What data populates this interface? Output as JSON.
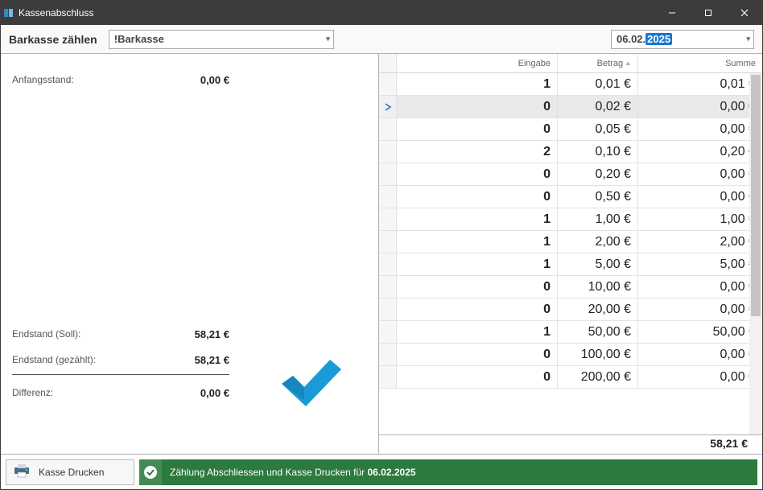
{
  "window": {
    "title": "Kassenabschluss"
  },
  "toolbar": {
    "label": "Barkasse zählen",
    "cashbox": "!Barkasse",
    "date_prefix": "06.02.",
    "date_sel": "2025"
  },
  "summary": {
    "start_label": "Anfangsstand:",
    "start_value": "0,00 €",
    "soll_label": "Endstand (Soll):",
    "soll_value": "58,21 €",
    "counted_label": "Endstand (gezählt):",
    "counted_value": "58,21 €",
    "diff_label": "Differenz:",
    "diff_value": "0,00 €"
  },
  "grid": {
    "headers": {
      "input": "Eingabe",
      "amount": "Betrag",
      "sum": "Summe"
    },
    "active_index": 1,
    "rows": [
      {
        "q": "1",
        "amt": "0,01 €",
        "sum": "0,01 €"
      },
      {
        "q": "0",
        "amt": "0,02 €",
        "sum": "0,00 €"
      },
      {
        "q": "0",
        "amt": "0,05 €",
        "sum": "0,00 €"
      },
      {
        "q": "2",
        "amt": "0,10 €",
        "sum": "0,20 €"
      },
      {
        "q": "0",
        "amt": "0,20 €",
        "sum": "0,00 €"
      },
      {
        "q": "0",
        "amt": "0,50 €",
        "sum": "0,00 €"
      },
      {
        "q": "1",
        "amt": "1,00 €",
        "sum": "1,00 €"
      },
      {
        "q": "1",
        "amt": "2,00 €",
        "sum": "2,00 €"
      },
      {
        "q": "1",
        "amt": "5,00 €",
        "sum": "5,00 €"
      },
      {
        "q": "0",
        "amt": "10,00 €",
        "sum": "0,00 €"
      },
      {
        "q": "0",
        "amt": "20,00 €",
        "sum": "0,00 €"
      },
      {
        "q": "1",
        "amt": "50,00 €",
        "sum": "50,00 €"
      },
      {
        "q": "0",
        "amt": "100,00 €",
        "sum": "0,00 €"
      },
      {
        "q": "0",
        "amt": "200,00 €",
        "sum": "0,00 €"
      }
    ],
    "total": "58,21 €"
  },
  "footer": {
    "print_label": "Kasse Drucken",
    "confirm_prefix": "Zählung Abschliessen und Kasse Drucken für ",
    "confirm_date": "06.02.2025"
  }
}
